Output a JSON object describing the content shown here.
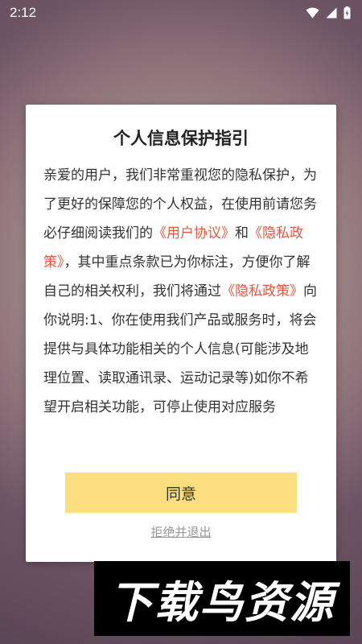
{
  "status_bar": {
    "time": "2:12",
    "icons": [
      "wifi-icon",
      "signal-icon",
      "battery-icon"
    ]
  },
  "dialog": {
    "title": "个人信息保护指引",
    "body": [
      {
        "type": "text",
        "value": "亲爱的用户，我们非常重视您的隐私保护，为了更好的保障您的个人权益，在使用前请您务必仔细阅读我们的"
      },
      {
        "type": "link",
        "value": "《用户协议》"
      },
      {
        "type": "text",
        "value": "和"
      },
      {
        "type": "link",
        "value": "《隐私政策》"
      },
      {
        "type": "text",
        "value": "，其中重点条款已为你标注，方便你了解自己的相关权利，我们将通过"
      },
      {
        "type": "link",
        "value": "《隐私政策》"
      },
      {
        "type": "text",
        "value": "向你说明:1、你在使用我们产品或服务时，将会提供与具体功能相关的个人信息(可能涉及地理位置、读取通讯录、运动记录等)如你不希望开启相关功能，可停止使用对应服务"
      }
    ],
    "agree_label": "同意",
    "reject_label": "拒绝并退出"
  },
  "watermark": {
    "text": "下载鸟资源"
  },
  "colors": {
    "link": "#e8563f",
    "button": "#fbde7e",
    "reject": "#999999"
  }
}
